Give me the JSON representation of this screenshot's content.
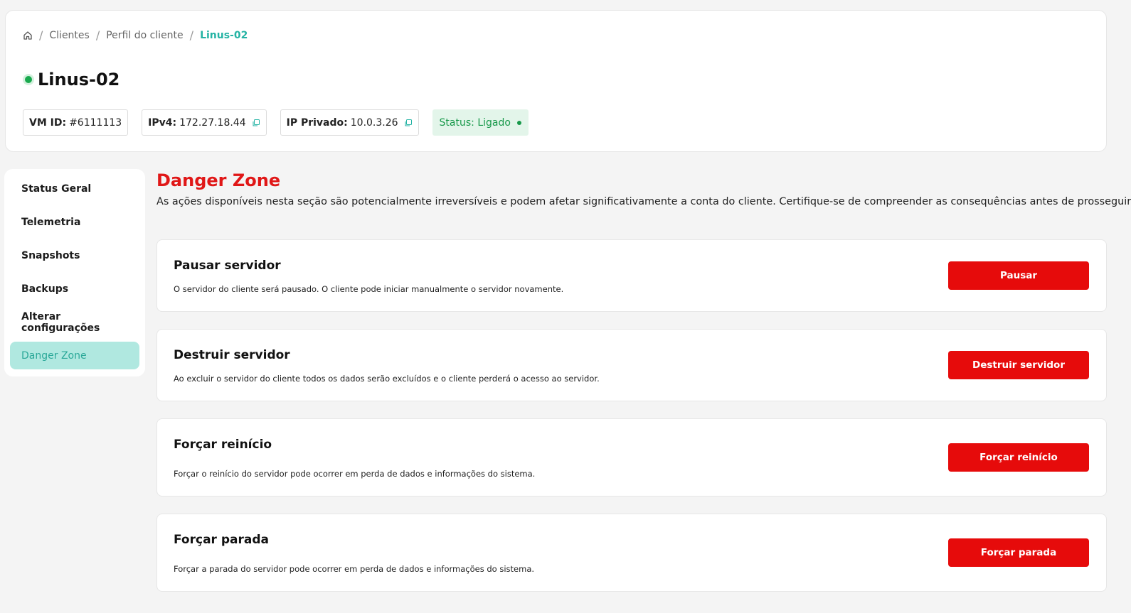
{
  "breadcrumb": {
    "home_icon": "home-icon",
    "separator": "/",
    "items": [
      "Clientes",
      "Perfil do cliente",
      "Linus-02"
    ]
  },
  "header": {
    "title": "Linus-02",
    "chips": {
      "vm_id_label": "VM ID:",
      "vm_id_value": "#6111113",
      "ipv4_label": "IPv4:",
      "ipv4_value": "172.27.18.44",
      "ip_private_label": "IP Privado:",
      "ip_private_value": "10.0.3.26",
      "status_text": "Status: Ligado"
    },
    "icons": {
      "copy": "copy-icon",
      "status_dot": "status-dot"
    }
  },
  "sidebar": {
    "items": [
      {
        "label": "Status Geral"
      },
      {
        "label": "Telemetria"
      },
      {
        "label": "Snapshots"
      },
      {
        "label": "Backups"
      },
      {
        "label": "Alterar configurações"
      },
      {
        "label": "Danger Zone",
        "active": true
      }
    ]
  },
  "danger_zone": {
    "title": "Danger Zone",
    "description": "As ações disponíveis nesta seção são potencialmente irreversíveis e podem afetar significativamente a conta do cliente. Certifique-se de compreender as consequências antes de prosseguir.",
    "actions": [
      {
        "title": "Pausar servidor",
        "description": "O servidor do cliente será pausado. O cliente pode iniciar manualmente o servidor novamente.",
        "button": "Pausar"
      },
      {
        "title": "Destruir servidor",
        "description": "Ao excluir o servidor do cliente todos os dados serão excluídos e o cliente perderá o acesso ao servidor.",
        "button": "Destruir servidor"
      },
      {
        "title": "Forçar reinício",
        "description": "Forçar o reinício do servidor pode ocorrer em perda de dados e informações do sistema.",
        "button": "Forçar reinício"
      },
      {
        "title": "Forçar parada",
        "description": "Forçar a parada do servidor pode ocorrer em perda de dados e informações do sistema.",
        "button": "Forçar parada"
      }
    ]
  },
  "colors": {
    "accent": "#24b3a4",
    "danger": "#e60b0b",
    "success": "#17994a",
    "active_bg": "#b0e8e0"
  }
}
